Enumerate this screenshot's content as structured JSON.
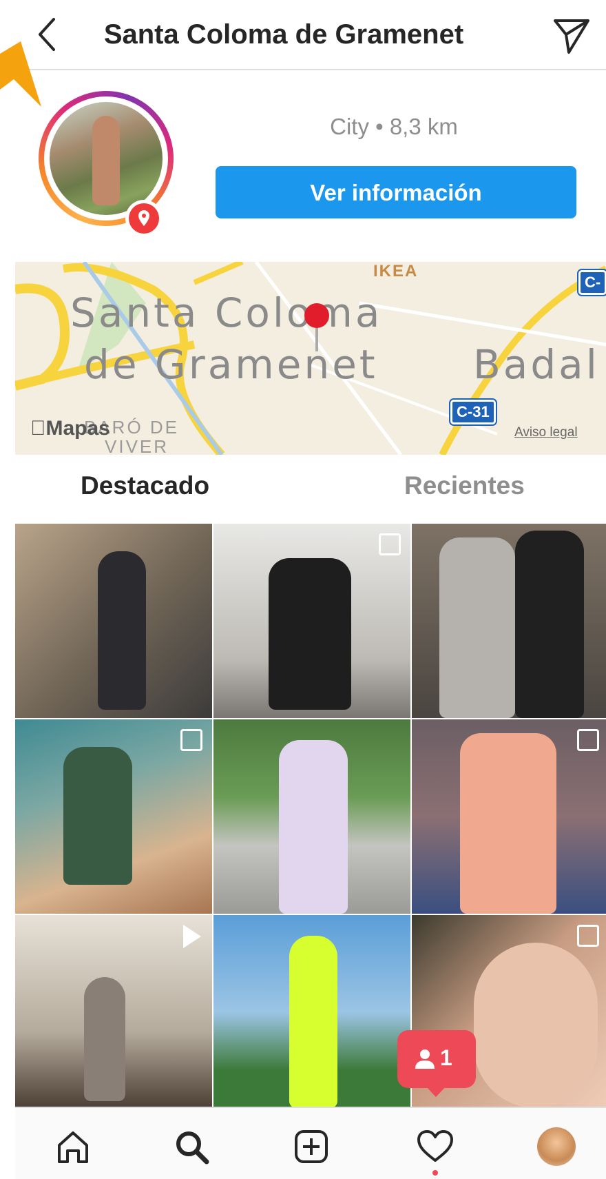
{
  "header": {
    "title": "Santa Coloma de Gramenet"
  },
  "profile": {
    "info": "City • 8,3 km",
    "button_label": "Ver información"
  },
  "map": {
    "label_line1": "Santa Coloma",
    "label_line2": "de Gramenet",
    "label_right": "Badal",
    "district_line1": "BARÓ DE",
    "district_line2": "VIVER",
    "poi": "IKEA",
    "road_main": "C-31",
    "road_top": "C-",
    "brand": "Mapas",
    "legal": "Aviso legal"
  },
  "tabs": [
    {
      "label": "Destacado"
    },
    {
      "label": "Recientes"
    }
  ],
  "grid_icons": [
    "none",
    "multi-icon",
    "none",
    "multi-icon",
    "none",
    "multi-icon",
    "play-icon",
    "none",
    "multi-icon"
  ],
  "notification": {
    "icon": "person-icon",
    "count": "1"
  },
  "bottom_nav": [
    {
      "name": "home-icon"
    },
    {
      "name": "search-icon"
    },
    {
      "name": "add-icon"
    },
    {
      "name": "heart-icon"
    },
    {
      "name": "profile-avatar"
    }
  ],
  "colors": {
    "accent_blue": "#1c97ee",
    "notification_red": "#ed4956",
    "arrow_orange": "#f4a30e"
  }
}
